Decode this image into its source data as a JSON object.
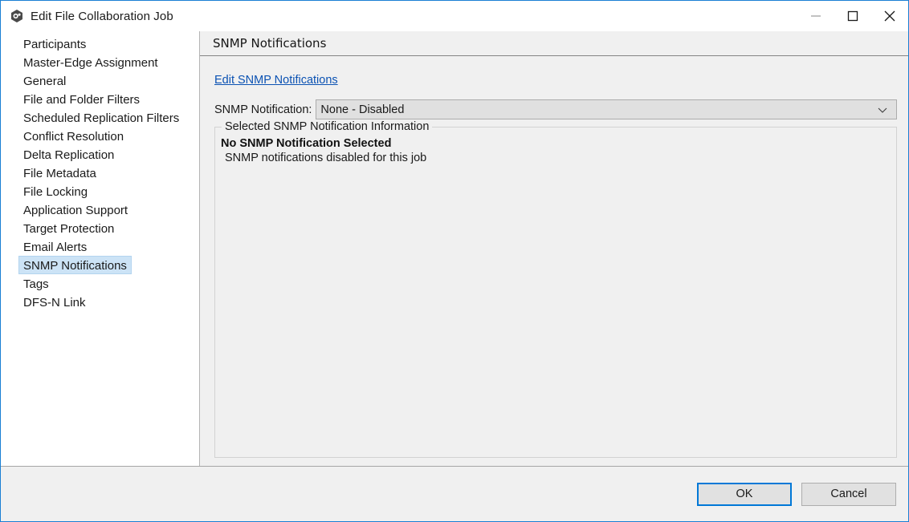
{
  "window": {
    "title": "Edit File Collaboration Job",
    "icon": "app-hexagon-icon",
    "accent_color": "#1a7fd4",
    "controls": {
      "minimize": "minimize-icon",
      "maximize": "maximize-icon",
      "close": "close-icon"
    }
  },
  "sidebar": {
    "items": [
      {
        "label": "Participants",
        "selected": false
      },
      {
        "label": "Master-Edge Assignment",
        "selected": false
      },
      {
        "label": "General",
        "selected": false
      },
      {
        "label": "File and Folder Filters",
        "selected": false
      },
      {
        "label": "Scheduled Replication Filters",
        "selected": false
      },
      {
        "label": "Conflict Resolution",
        "selected": false
      },
      {
        "label": "Delta Replication",
        "selected": false
      },
      {
        "label": "File Metadata",
        "selected": false
      },
      {
        "label": "File Locking",
        "selected": false
      },
      {
        "label": "Application Support",
        "selected": false
      },
      {
        "label": "Target Protection",
        "selected": false
      },
      {
        "label": "Email Alerts",
        "selected": false
      },
      {
        "label": "SNMP Notifications",
        "selected": true
      },
      {
        "label": "Tags",
        "selected": false
      },
      {
        "label": "DFS-N Link",
        "selected": false
      }
    ],
    "selected_highlight_color": "#cce3f6"
  },
  "content": {
    "title": "SNMP Notifications",
    "edit_link": "Edit SNMP Notifications",
    "field": {
      "label": "SNMP Notification:",
      "value": "None - Disabled",
      "options": [
        "None - Disabled"
      ]
    },
    "group": {
      "legend": "Selected SNMP Notification Information",
      "heading": "No SNMP Notification Selected",
      "description": "SNMP notifications disabled for this job"
    }
  },
  "footer": {
    "ok_label": "OK",
    "cancel_label": "Cancel",
    "ok_border_color": "#0078d7"
  }
}
